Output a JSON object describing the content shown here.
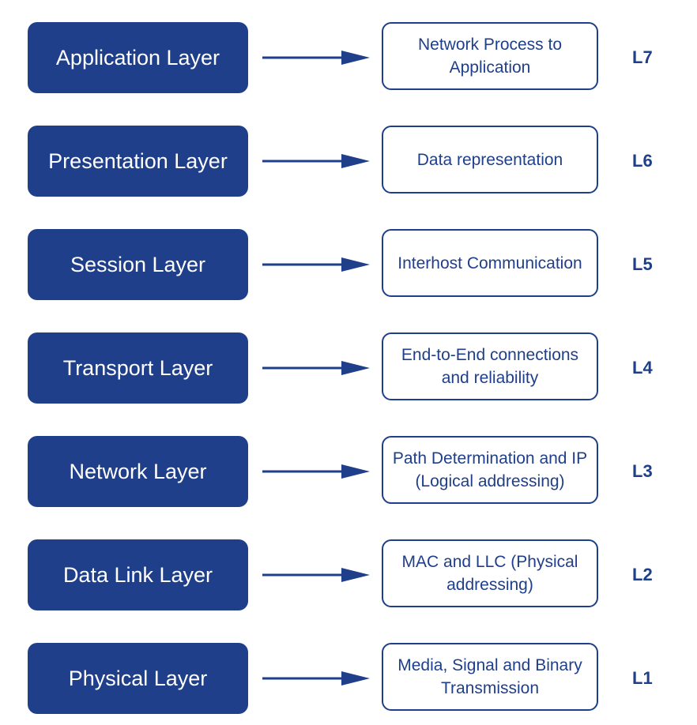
{
  "color": "#1f3f8a",
  "rows": [
    {
      "layer": "Application Layer",
      "desc": "Network Process to Application",
      "level": "L7"
    },
    {
      "layer": "Presentation Layer",
      "desc": "Data representation",
      "level": "L6"
    },
    {
      "layer": "Session Layer",
      "desc": "Interhost Communication",
      "level": "L5"
    },
    {
      "layer": "Transport Layer",
      "desc": "End-to-End connections and reliability",
      "level": "L4"
    },
    {
      "layer": "Network Layer",
      "desc": "Path Determination and IP (Logical addressing)",
      "level": "L3"
    },
    {
      "layer": "Data Link Layer",
      "desc": "MAC and LLC (Physical addressing)",
      "level": "L2"
    },
    {
      "layer": "Physical Layer",
      "desc": "Media, Signal and Binary Transmission",
      "level": "L1"
    }
  ]
}
